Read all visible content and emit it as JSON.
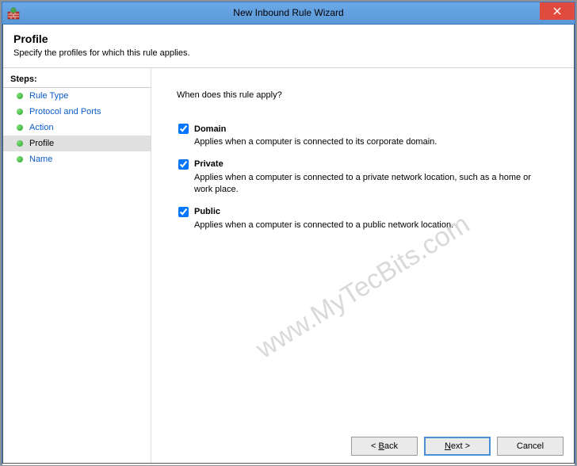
{
  "window": {
    "title": "New Inbound Rule Wizard"
  },
  "header": {
    "heading": "Profile",
    "subtitle": "Specify the profiles for which this rule applies."
  },
  "steps": {
    "label": "Steps:",
    "items": [
      {
        "label": "Rule Type",
        "active": false
      },
      {
        "label": "Protocol and Ports",
        "active": false
      },
      {
        "label": "Action",
        "active": false
      },
      {
        "label": "Profile",
        "active": true
      },
      {
        "label": "Name",
        "active": false
      }
    ]
  },
  "content": {
    "question": "When does this rule apply?",
    "options": [
      {
        "label": "Domain",
        "checked": true,
        "desc": "Applies when a computer is connected to its corporate domain."
      },
      {
        "label": "Private",
        "checked": true,
        "desc": "Applies when a computer is connected to a private network location, such as a home or work place."
      },
      {
        "label": "Public",
        "checked": true,
        "desc": "Applies when a computer is connected to a public network location."
      }
    ]
  },
  "buttons": {
    "back_prefix": "< ",
    "back_u": "B",
    "back_rest": "ack",
    "next_u": "N",
    "next_rest": "ext >",
    "cancel": "Cancel"
  },
  "watermark": "www.MyTecBits.com"
}
